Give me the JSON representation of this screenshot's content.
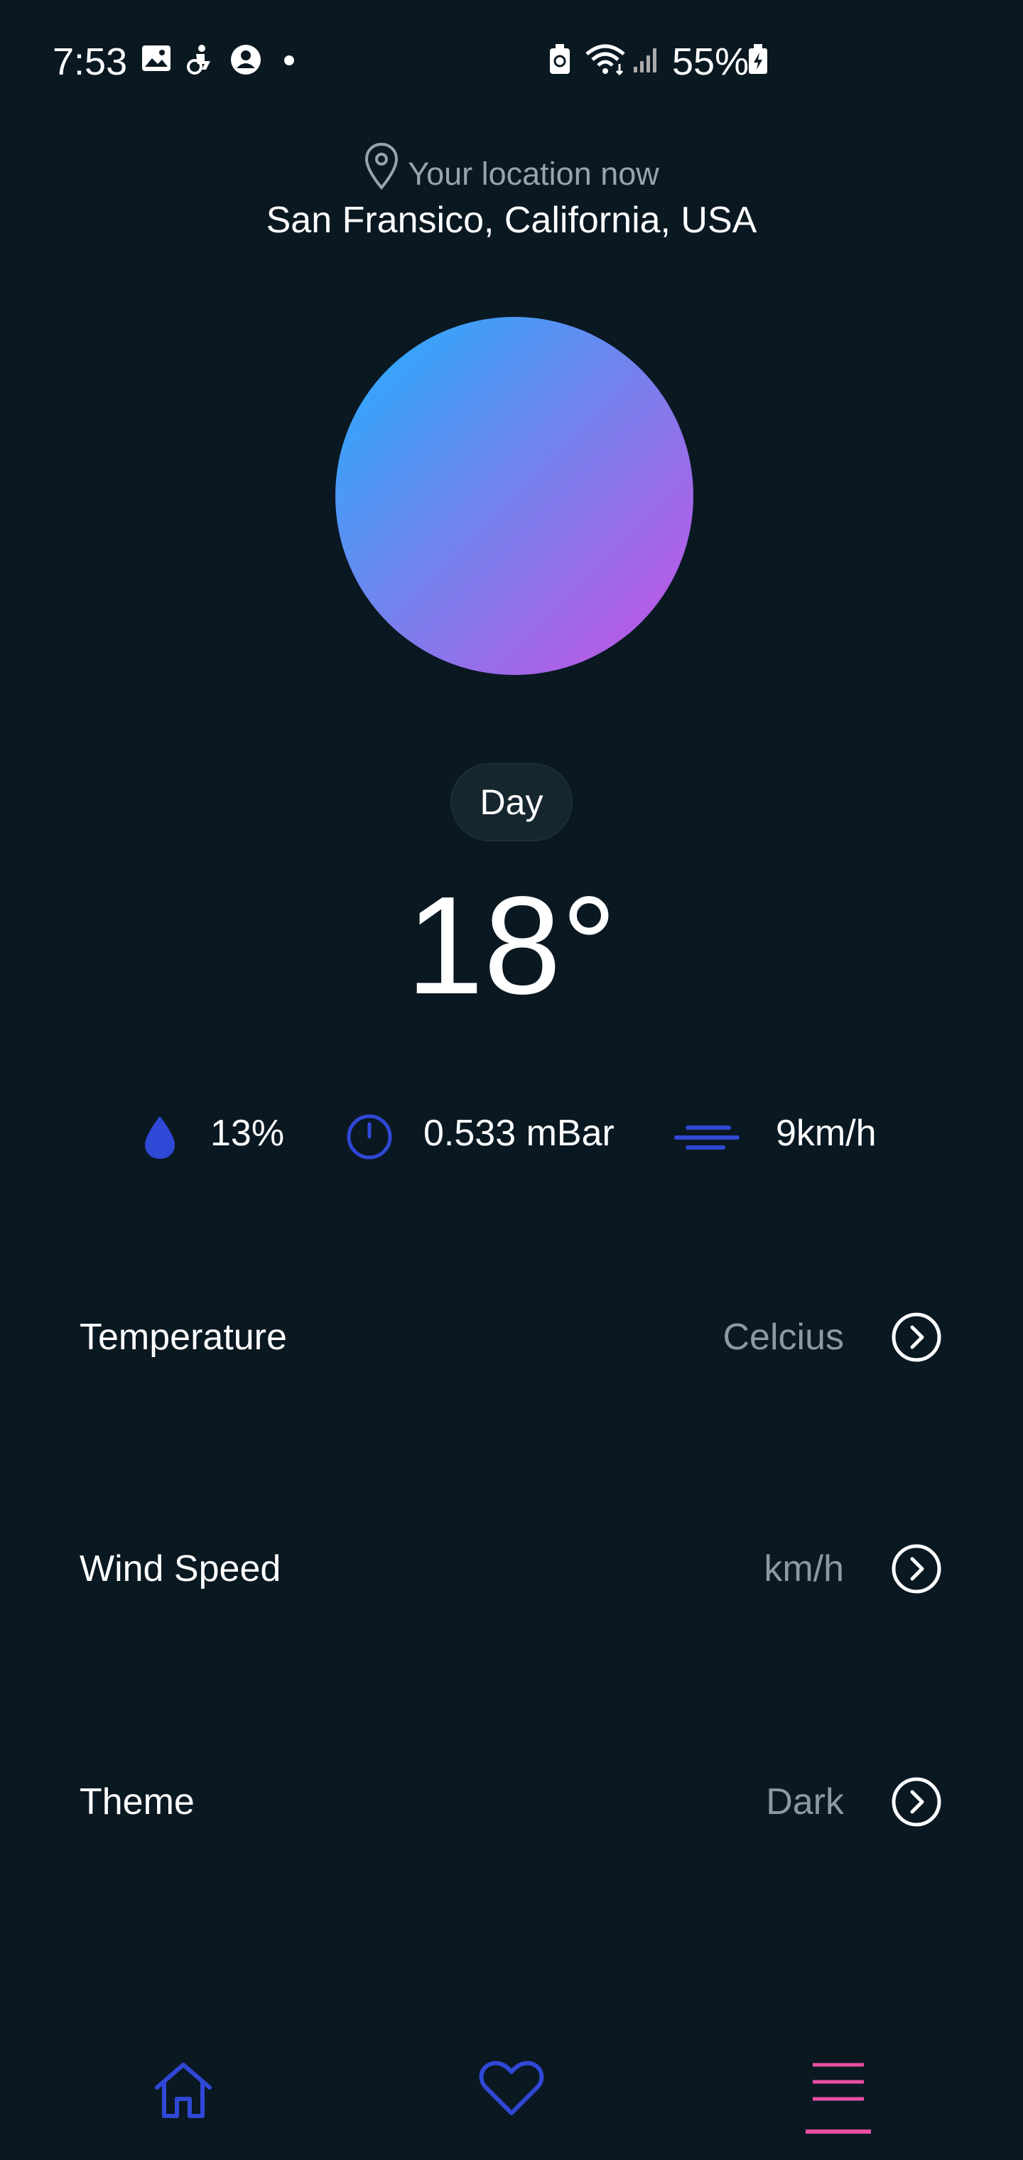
{
  "status_bar": {
    "time": "7:53",
    "battery": "55%",
    "icons": [
      "gallery-icon",
      "accessibility-icon",
      "account-icon",
      "dot-icon",
      "battery-saver-icon",
      "wifi-icon",
      "signal-icon",
      "battery-icon"
    ]
  },
  "location": {
    "hint": "Your location now",
    "city": "San Fransico, California, USA"
  },
  "weather": {
    "period": "Day",
    "temperature": "18°",
    "humidity": "13%",
    "pressure": "0.533 mBar",
    "wind": "9km/h"
  },
  "settings": [
    {
      "label": "Temperature",
      "value": "Celcius"
    },
    {
      "label": "Wind Speed",
      "value": "km/h"
    },
    {
      "label": "Theme",
      "value": "Dark"
    }
  ],
  "nav": {
    "items": [
      "home-icon",
      "favorites-icon",
      "menu-icon"
    ],
    "active": "menu-icon"
  },
  "colors": {
    "background": "#0a1822",
    "accent_blue": "#2f48d6",
    "accent_pink": "#e94fa3",
    "orb_start": "#1fb0ff",
    "orb_end": "#c756e3"
  }
}
